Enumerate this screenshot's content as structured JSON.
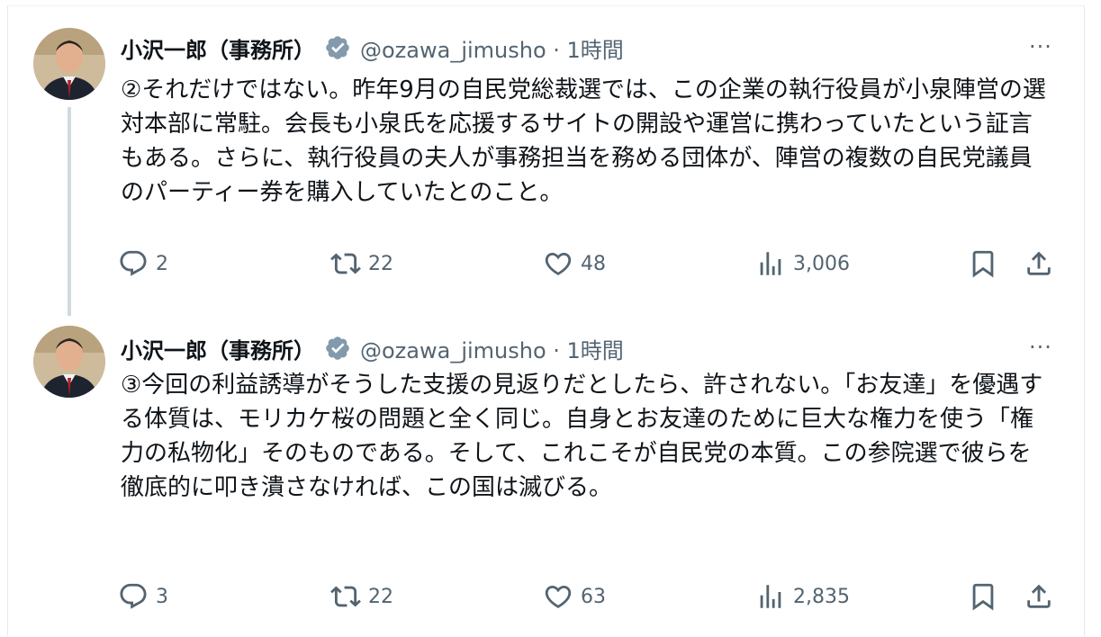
{
  "tweets": [
    {
      "author_name": "小沢一郎（事務所）",
      "handle_time": "@ozawa_jimusho · 1時間",
      "more": "···",
      "text": "②それだけではない。昨年9月の自民党総裁選では、この企業の執行役員が小泉陣営の選対本部に常駐。会長も小泉氏を応援するサイトの開設や運営に携わっていたという証言もある。さらに、執行役員の夫人が事務担当を務める団体が、陣営の複数の自民党議員のパーティー券を購入していたとのこと。",
      "replies": "2",
      "retweets": "22",
      "likes": "48",
      "views": "3,006"
    },
    {
      "author_name": "小沢一郎（事務所）",
      "handle_time": "@ozawa_jimusho · 1時間",
      "more": "···",
      "text": "③今回の利益誘導がそうした支援の見返りだとしたら、許されない。「お友達」を優遇する体質は、モリカケ桜の問題と全く同じ。自身とお友達のために巨大な権力を使う「権力の私物化」そのものである。そして、これこそが自民党の本質。この参院選で彼らを徹底的に叩き潰さなければ、この国は滅びる。",
      "replies": "3",
      "retweets": "22",
      "likes": "63",
      "views": "2,835"
    }
  ],
  "icons": {
    "verified": "verified-badge-icon",
    "reply": "reply-icon",
    "retweet": "retweet-icon",
    "like": "heart-icon",
    "views": "views-bar-chart-icon",
    "bookmark": "bookmark-icon",
    "share": "share-icon"
  },
  "colors": {
    "verified_badge": "#829aab",
    "secondary_text": "#536471",
    "thread_line": "#cfd9de"
  }
}
